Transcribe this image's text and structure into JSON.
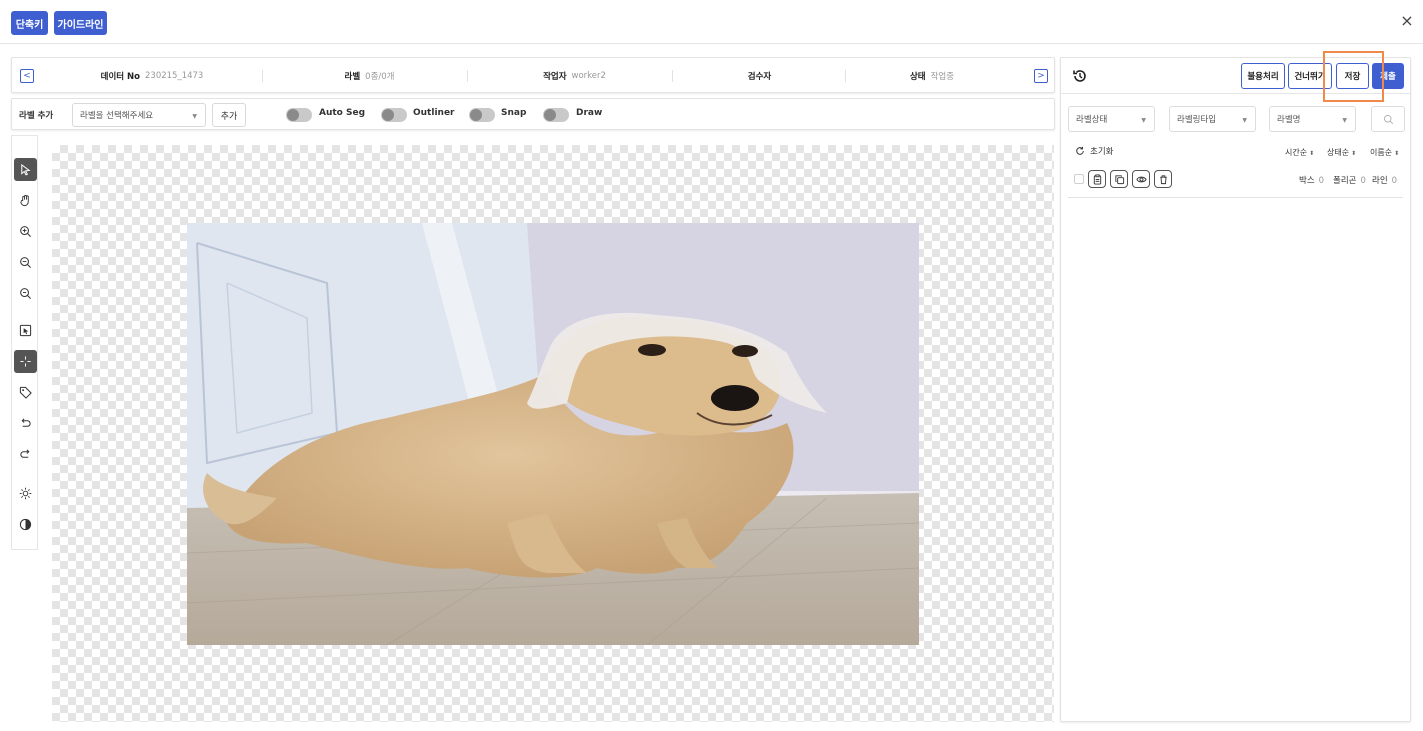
{
  "topbar": {
    "shortcut_label": "단축키",
    "guideline_label": "가이드라인",
    "close_label": "×"
  },
  "info": {
    "prev_label": "<",
    "next_label": ">",
    "data_no_key": "데이터 No",
    "data_no_value": "230215_1473",
    "label_key": "라벨",
    "label_value": "0종/0개",
    "worker_key": "작업자",
    "worker_value": "worker2",
    "reviewer_key": "검수자",
    "reviewer_value": "",
    "status_key": "상태",
    "status_value": "작업중"
  },
  "labelbar": {
    "title": "라벨 추가",
    "select_placeholder": "라벨을 선택해주세요",
    "add_label": "추가",
    "toggles": [
      {
        "label": "Auto Seg",
        "on": false
      },
      {
        "label": "Outliner",
        "on": false
      },
      {
        "label": "Snap",
        "on": false
      },
      {
        "label": "Draw",
        "on": false
      }
    ]
  },
  "tools": [
    {
      "icon": "select-arrow-icon",
      "active": true
    },
    {
      "icon": "hand-icon",
      "active": false
    },
    {
      "icon": "zoom-in-icon",
      "active": false
    },
    {
      "icon": "zoom-out-icon",
      "active": false
    },
    {
      "icon": "zoom-fit-icon",
      "active": false
    },
    {
      "icon": "box-select-icon",
      "active": false
    },
    {
      "icon": "crosshair-icon",
      "active": true
    },
    {
      "icon": "tag-icon",
      "active": false
    },
    {
      "icon": "undo-icon",
      "active": false
    },
    {
      "icon": "redo-icon",
      "active": false
    },
    {
      "icon": "brightness-icon",
      "active": false
    },
    {
      "icon": "contrast-icon",
      "active": false
    }
  ],
  "right": {
    "history_icon": "history-icon",
    "reject_label": "불용처리",
    "skip_label": "건너뛰기",
    "save_label": "저장",
    "submit_label": "제출",
    "filter_status": "라벨상태",
    "filter_type": "라벨링타입",
    "filter_name": "라벨명",
    "reset_label": "초기화",
    "sort": [
      "시간순",
      "상태순",
      "이름순"
    ],
    "counts": [
      {
        "label": "박스",
        "value": "0"
      },
      {
        "label": "폴리곤",
        "value": "0"
      },
      {
        "label": "라인",
        "value": "0"
      }
    ],
    "highlight_color": "#f08a4b"
  },
  "colors": {
    "accent": "#3f5fd1"
  }
}
